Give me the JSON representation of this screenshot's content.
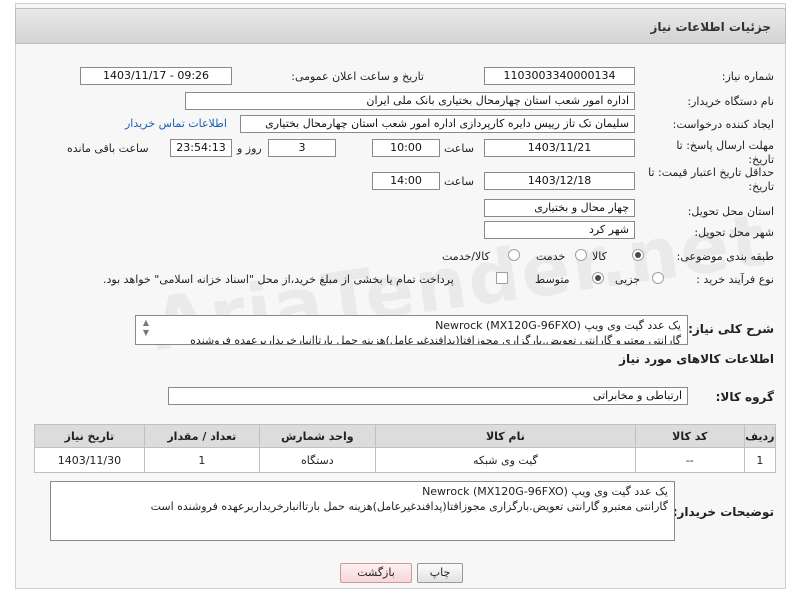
{
  "header": {
    "title": "جزئیات اطلاعات نیاز"
  },
  "form": {
    "need_number_label": "شماره نیاز:",
    "need_number": "1103003340000134",
    "announce_label": "تاریخ و ساعت اعلان عمومی:",
    "announce_value": "1403/11/17 - 09:26",
    "buyer_org_label": "نام دستگاه خریدار:",
    "buyer_org": "اداره امور شعب استان چهارمحال بختیاری بانک ملی ایران",
    "creator_label": "ایجاد کننده درخواست:",
    "creator": "سلیمان تک تاز رییس دایره کارپردازی  اداره امور شعب استان چهارمحال بختیاری",
    "contact_link": "اطلاعات تماس خریدار",
    "deadline_label_1": "مهلت ارسال پاسخ: تا",
    "deadline_label_2": "تاریخ:",
    "deadline_date": "1403/11/21",
    "time_label": "ساعت",
    "deadline_time": "10:00",
    "days_value": "3",
    "days_label": "روز و",
    "remaining_time": "23:54:13",
    "remaining_label": "ساعت باقی مانده",
    "validity_label_1": "حداقل تاریخ اعتبار قیمت: تا",
    "validity_label_2": "تاریخ:",
    "validity_date": "1403/12/18",
    "validity_time": "14:00",
    "province_label": "استان محل تحویل:",
    "province": "چهار محال و بختیاری",
    "city_label": "شهر محل تحویل:",
    "city": "شهر کرد",
    "category_label": "طبقه بندی موضوعی:",
    "category_options": [
      "کالا",
      "خدمت",
      "کالا/خدمت"
    ],
    "process_label": "نوع فرآیند خرید :",
    "process_options": [
      "جزیی",
      "متوسط"
    ],
    "payment_note": "پرداخت تمام یا بخشی از مبلغ خرید،از محل \"اسناد خزانه اسلامی\" خواهد بود."
  },
  "summary": {
    "label": "شرح کلی نیاز:",
    "line1": "یک عدد گیت وی ویپ (MX120G-96FXO) Newrock",
    "line2": "گارانتی معتبرو گارانتی تعویض.بارگزاری مجوزافتا(پدافندغیرعامل)هزینه حمل بارتاانبارخریداربرعهده فروشنده"
  },
  "goods": {
    "section_title": "اطلاعات کالاهای مورد نیاز",
    "group_label": "گروه کالا:",
    "group_value": "ارتباطی و مخابراتی",
    "columns": [
      "ردیف",
      "کد کالا",
      "نام کالا",
      "واحد شمارش",
      "تعداد / مقدار",
      "تاریخ نیاز"
    ],
    "rows": [
      {
        "index": "1",
        "code": "--",
        "name": "گیت وی شبکه",
        "unit": "دستگاه",
        "qty": "1",
        "date": "1403/11/30"
      }
    ]
  },
  "buyer_notes": {
    "label": "توضیحات خریدار:",
    "line1": "یک عدد گیت وی ویپ (MX120G-96FXO) Newrock",
    "line2": "گارانتی معتبرو گارانتی تعویض.بارگزاری مجوزافتا(پدافندغیرعامل)هزینه حمل بارتاانبارخریداربرعهده فروشنده است"
  },
  "buttons": {
    "print": "چاپ",
    "back": "بازگشت"
  },
  "watermark": "AriaTender.net"
}
